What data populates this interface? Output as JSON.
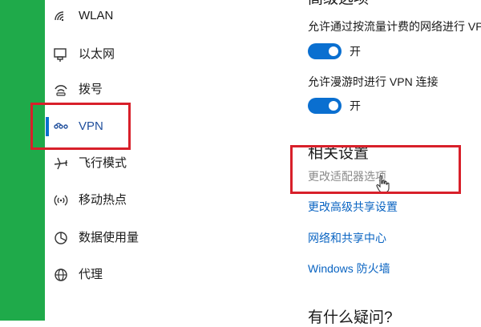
{
  "sidebar": {
    "items": [
      {
        "label": "WLAN",
        "icon": "wifi-icon"
      },
      {
        "label": "以太网",
        "icon": "ethernet-icon"
      },
      {
        "label": "拨号",
        "icon": "dialup-icon"
      },
      {
        "label": "VPN",
        "icon": "vpn-icon",
        "selected": true
      },
      {
        "label": "飞行模式",
        "icon": "airplane-icon"
      },
      {
        "label": "移动热点",
        "icon": "hotspot-icon"
      },
      {
        "label": "数据使用量",
        "icon": "data-usage-icon"
      },
      {
        "label": "代理",
        "icon": "globe-icon"
      }
    ]
  },
  "main": {
    "top_heading_partial": "高级选项",
    "metered_setting": {
      "label": "允许通过按流量计费的网络进行 VPN",
      "state": "开"
    },
    "roaming_setting": {
      "label": "允许漫游时进行 VPN 连接",
      "state": "开"
    },
    "related_settings": {
      "heading": "相关设置",
      "links": [
        "更改适配器选项",
        "更改高级共享设置",
        "网络和共享中心",
        "Windows 防火墙"
      ]
    },
    "bottom_heading_partial": "有什么疑问?"
  },
  "colors": {
    "accent": "#0a6fd0",
    "link": "#0a64c2",
    "annotation": "#d8202a",
    "side_strip": "#1faa4a"
  }
}
